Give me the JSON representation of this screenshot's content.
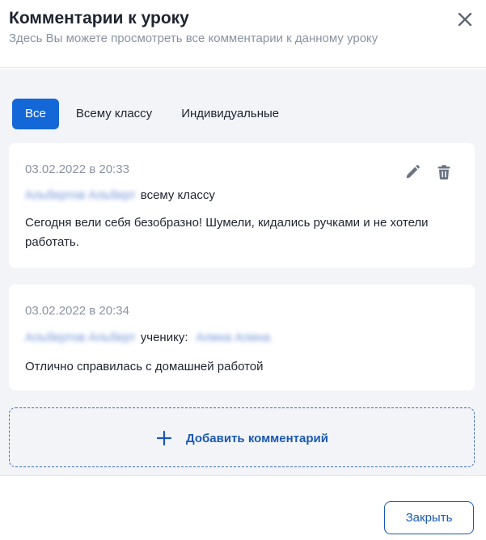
{
  "header": {
    "title": "Комментарии к уроку",
    "subtitle": "Здесь Вы можете просмотреть все комментарии к данному уроку",
    "close_icon": "close-icon"
  },
  "tabs": [
    {
      "label": "Все",
      "active": true
    },
    {
      "label": "Всему классу",
      "active": false
    },
    {
      "label": "Индивидуальные",
      "active": false
    }
  ],
  "comments": [
    {
      "date": "03.02.2022 в 20:33",
      "author": "Альбертов Альберт",
      "target": "всему классу",
      "recipient": "",
      "text": "Сегодня вели себя безобразно! Шумели, кидались ручками и не хотели работать.",
      "icons": [
        "pencil-icon",
        "trash-icon"
      ]
    },
    {
      "date": "03.02.2022 в 20:34",
      "author": "Альбертов Альберт",
      "target": "ученику:",
      "recipient": "Алина Алина",
      "text": "Отлично справилась с домашней работой"
    }
  ],
  "add_comment": {
    "label": "Добавить комментарий",
    "icon": "plus-icon"
  },
  "footer": {
    "close_label": "Закрыть"
  },
  "colors": {
    "accent": "#1467d6",
    "link": "#1a58b8",
    "muted": "#8a93a3",
    "background": "#f3f4f7"
  }
}
